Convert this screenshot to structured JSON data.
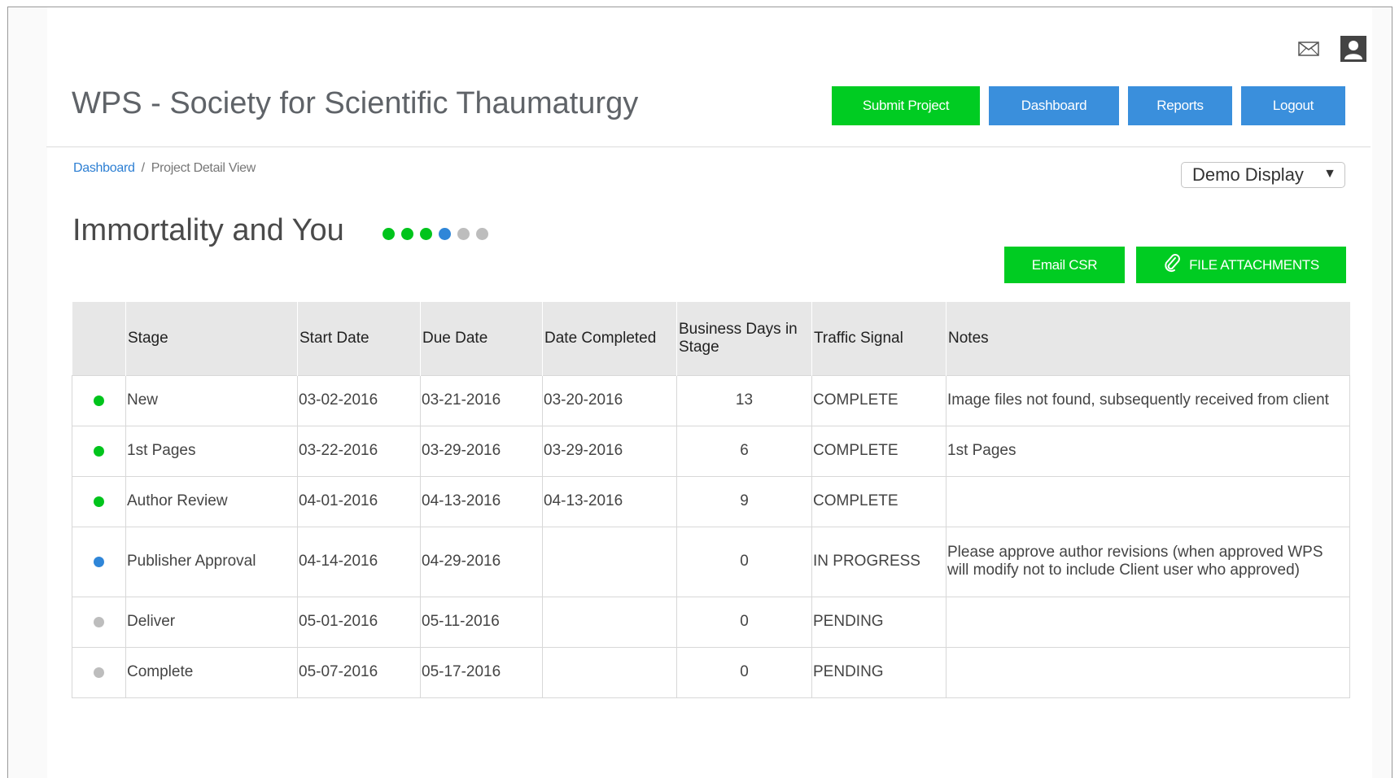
{
  "header": {
    "app_title": "WPS - Society for Scientific Thaumaturgy",
    "nav": {
      "submit_label": "Submit Project",
      "dashboard_label": "Dashboard",
      "reports_label": "Reports",
      "logout_label": "Logout"
    },
    "icons": {
      "mail": "mail-icon",
      "user": "user-icon"
    }
  },
  "breadcrumb": {
    "link": "Dashboard",
    "separator": "/",
    "current": "Project Detail View"
  },
  "display_select": {
    "selected": "Demo Display"
  },
  "project": {
    "title": "Immortality and You",
    "progress": [
      "complete",
      "complete",
      "complete",
      "in-progress",
      "pending",
      "pending"
    ]
  },
  "actions": {
    "email_label": "Email CSR",
    "files_label": "FILE ATTACHMENTS",
    "files_icon": "paperclip-icon"
  },
  "colors": {
    "complete": "#00c41c",
    "in-progress": "#2f86d8",
    "pending": "#bdbdbd",
    "green_button": "#00cc22",
    "blue_button": "#3a8fdc"
  },
  "table": {
    "headers": [
      "",
      "Stage",
      "Start Date",
      "Due Date",
      "Date Completed",
      "Business Days in Stage",
      "Traffic Signal",
      "Notes"
    ],
    "rows": [
      {
        "status": "complete",
        "stage": "New",
        "start": "03-02-2016",
        "due": "03-21-2016",
        "completed": "03-20-2016",
        "days": "13",
        "signal": "COMPLETE",
        "notes": "Image files not found, subsequently received from client"
      },
      {
        "status": "complete",
        "stage": "1st Pages",
        "start": "03-22-2016",
        "due": "03-29-2016",
        "completed": "03-29-2016",
        "days": "6",
        "signal": "COMPLETE",
        "notes": "1st Pages"
      },
      {
        "status": "complete",
        "stage": "Author Review",
        "start": "04-01-2016",
        "due": "04-13-2016",
        "completed": "04-13-2016",
        "days": "9",
        "signal": "COMPLETE",
        "notes": ""
      },
      {
        "status": "in-progress",
        "stage": "Publisher Approval",
        "start": "04-14-2016",
        "due": "04-29-2016",
        "completed": "",
        "days": "0",
        "signal": "IN PROGRESS",
        "notes": "Please approve author revisions (when approved WPS will modify not to include Client user who approved)"
      },
      {
        "status": "pending",
        "stage": "Deliver",
        "start": "05-01-2016",
        "due": "05-11-2016",
        "completed": "",
        "days": "0",
        "signal": "PENDING",
        "notes": ""
      },
      {
        "status": "pending",
        "stage": "Complete",
        "start": "05-07-2016",
        "due": "05-17-2016",
        "completed": "",
        "days": "0",
        "signal": "PENDING",
        "notes": ""
      }
    ]
  }
}
